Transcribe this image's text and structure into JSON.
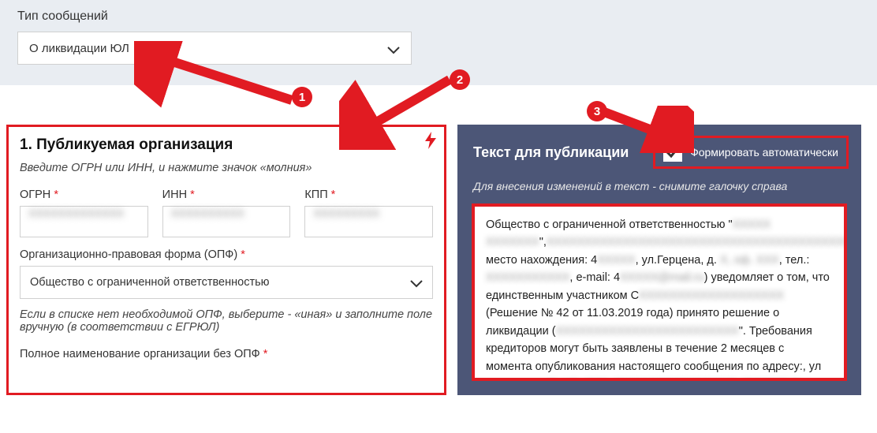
{
  "top": {
    "label": "Тип сообщений",
    "selected": "О ликвидации ЮЛ"
  },
  "badges": {
    "b1": "1",
    "b2": "2",
    "b3": "3"
  },
  "left": {
    "heading": "1. Публикуемая организация",
    "hint": "Введите ОГРН или ИНН, и нажмите значок «молния»",
    "ogrn_label": "ОГРН",
    "inn_label": "ИНН",
    "kpp_label": "КПП",
    "ogrn_value": "XXXXXXXXXXXXX",
    "inn_value": "XXXXXXXXXX",
    "kpp_value": "XXXXXXXXX",
    "opf_label": "Организационно-правовая форма (ОПФ)",
    "opf_selected": "Общество с ограниченной ответственностью",
    "opf_hint": "Если в списке нет необходимой ОПФ, выберите - «иная» и заполните поле вручную (в соответствии с ЕГРЮЛ)",
    "fullname_label": "Полное наименование организации без ОПФ"
  },
  "right": {
    "title": "Текст для публикации",
    "auto_label": "Формировать автоматически",
    "sub": "Для внесения изменений в текст - снимите галочку справа",
    "body_prefix": "Общество с ограниченной ответственностью \"",
    "body_mid1": "место нахождения: 4",
    "body_mid1b": ", ул.Герцена, д. ",
    "body_mid1c": ", тел.: ",
    "body_mid2": ", e-mail: 4",
    "body_mid2b": ") уведомляет о том, что единственным участником С",
    "body_mid3": " (Решение № 42 от 11.03.2019 года) принято решение о ликвидации (",
    "body_mid4": "\". Требования кредиторов могут быть заявлены в течение 2 месяцев с момента опубликования настоящего сообщения по адресу:, ул Герцена, д. "
  }
}
